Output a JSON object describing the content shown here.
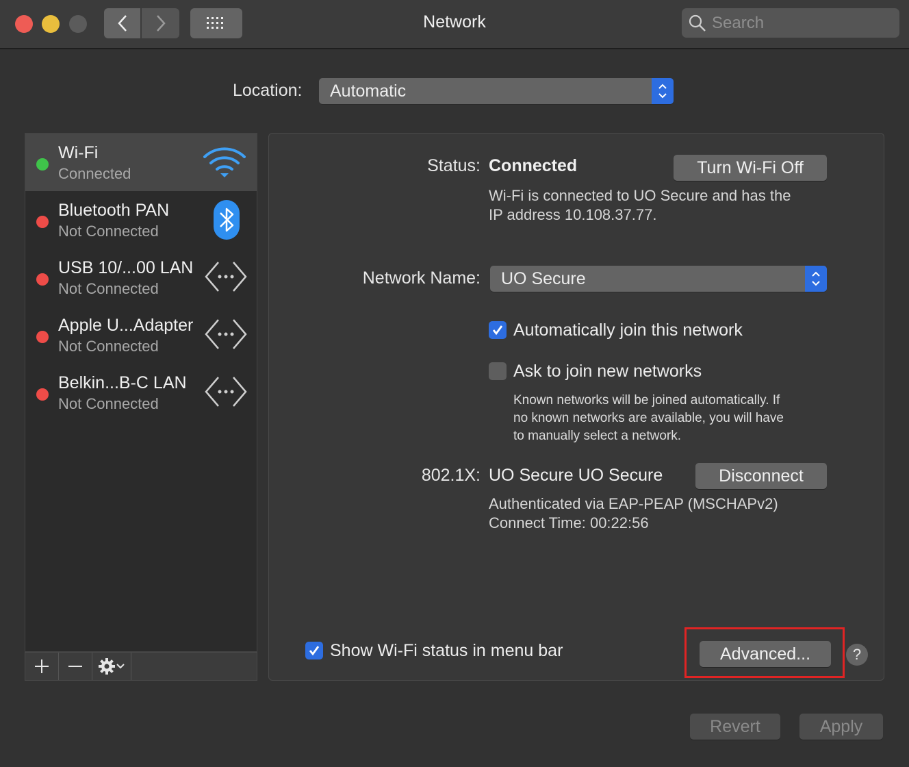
{
  "window": {
    "title": "Network",
    "search_placeholder": "Search"
  },
  "location": {
    "label": "Location:",
    "value": "Automatic"
  },
  "services": [
    {
      "name": "Wi-Fi",
      "status": "Connected",
      "dot": "#3fc34a",
      "icon": "wifi-icon"
    },
    {
      "name": "Bluetooth PAN",
      "status": "Not Connected",
      "dot": "#ee4c48",
      "icon": "bluetooth-icon"
    },
    {
      "name": "USB 10/...00 LAN",
      "status": "Not Connected",
      "dot": "#ee4c48",
      "icon": "ethernet-icon"
    },
    {
      "name": "Apple U...Adapter",
      "status": "Not Connected",
      "dot": "#ee4c48",
      "icon": "ethernet-icon"
    },
    {
      "name": "Belkin...B-C LAN",
      "status": "Not Connected",
      "dot": "#ee4c48",
      "icon": "ethernet-icon"
    }
  ],
  "detail": {
    "status_label": "Status:",
    "status_value": "Connected",
    "turn_off_button": "Turn Wi-Fi Off",
    "status_description_line1": "Wi-Fi is connected to UO Secure and has the",
    "status_description_line2": "IP address 10.108.37.77.",
    "network_name_label": "Network Name:",
    "network_name_value": "UO Secure",
    "auto_join_label": "Automatically join this network",
    "auto_join_checked": true,
    "ask_join_label": "Ask to join new networks",
    "ask_join_checked": false,
    "ask_join_note_line1": "Known networks will be joined automatically. If",
    "ask_join_note_line2": "no known networks are available, you will have",
    "ask_join_note_line3": "to manually select a network.",
    "dot1x_label": "802.1X:",
    "dot1x_value": "UO Secure UO Secure",
    "disconnect_button": "Disconnect",
    "auth_line": "Authenticated via EAP-PEAP (MSCHAPv2)",
    "connect_time": "Connect Time: 00:22:56",
    "show_status_label": "Show Wi-Fi status in menu bar",
    "show_status_checked": true,
    "advanced_button": "Advanced...",
    "help_button": "?"
  },
  "footer": {
    "revert_button": "Revert",
    "apply_button": "Apply"
  },
  "colors": {
    "accent": "#2d6de0",
    "highlight": "#e02424"
  }
}
